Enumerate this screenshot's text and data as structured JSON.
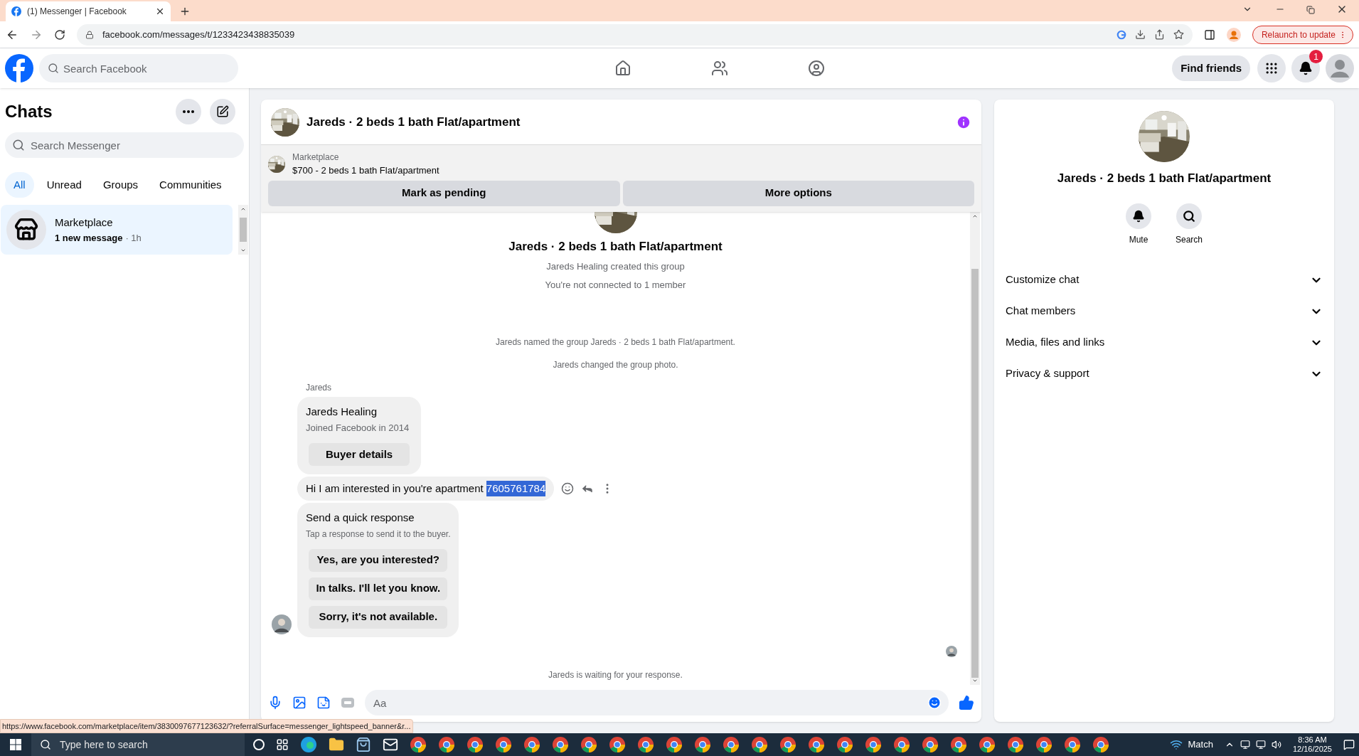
{
  "browser": {
    "tab_title": "(1) Messenger | Facebook",
    "url": "facebook.com/messages/t/1233423438835039",
    "relaunch_button": "Relaunch to update"
  },
  "header": {
    "search_placeholder": "Search Facebook",
    "find_friends": "Find friends",
    "notification_count": "1"
  },
  "sidebar": {
    "title": "Chats",
    "search_placeholder": "Search Messenger",
    "filters": [
      {
        "label": "All",
        "selected": true
      },
      {
        "label": "Unread",
        "selected": false
      },
      {
        "label": "Groups",
        "selected": false
      },
      {
        "label": "Communities",
        "selected": false
      }
    ],
    "chats": [
      {
        "name": "Marketplace",
        "preview": "1 new message",
        "time": "· 1h",
        "selected": true
      }
    ]
  },
  "chat": {
    "title": "Jareds · 2 beds 1 bath Flat/apartment",
    "listing": {
      "source": "Marketplace",
      "summary": "$700 - 2 beds 1 bath Flat/apartment"
    },
    "listing_actions": [
      "Mark as pending",
      "More options"
    ],
    "intro": {
      "title": "Jareds · 2 beds 1 bath Flat/apartment",
      "lines": [
        "Jareds Healing created this group",
        "You're not connected to 1 member"
      ]
    },
    "events": [
      "Jareds named the group Jareds · 2 beds 1 bath Flat/apartment.",
      "Jareds changed the group photo."
    ],
    "sender_label": "Jareds",
    "buyer_card": {
      "name": "Jareds Healing",
      "subtitle": "Joined Facebook in 2014",
      "button": "Buyer details"
    },
    "message": [
      {
        "text": "Hi I am interested in you're apartment ",
        "selected": false
      },
      {
        "text": "7605761784",
        "selected": true
      }
    ],
    "quick_response": {
      "title": "Send a quick response",
      "hint": "Tap a response to send it to the buyer.",
      "options": [
        "Yes, are you interested?",
        "In talks. I'll let you know.",
        "Sorry, it's not available."
      ]
    },
    "waiting_note": "Jareds is waiting for your response.",
    "composer_placeholder": "Aa"
  },
  "details": {
    "title": "Jareds · 2 beds 1 bath Flat/apartment",
    "actions": [
      {
        "kind": "mute",
        "label": "Mute"
      },
      {
        "kind": "search",
        "label": "Search"
      }
    ],
    "sections": [
      {
        "label": "Customize chat",
        "expanded": false
      },
      {
        "label": "Chat members",
        "expanded": false
      },
      {
        "label": "Media, files and links",
        "expanded": false
      },
      {
        "label": "Privacy & support",
        "expanded": false
      }
    ]
  },
  "status_url": "https://www.facebook.com/marketplace/item/3830097677123632/?referralSurface=messenger_lightspeed_banner&r...",
  "taskbar": {
    "search_placeholder": "Type here to search",
    "weather": "Match",
    "time": "8:36 AM",
    "date": "12/16/2025"
  }
}
